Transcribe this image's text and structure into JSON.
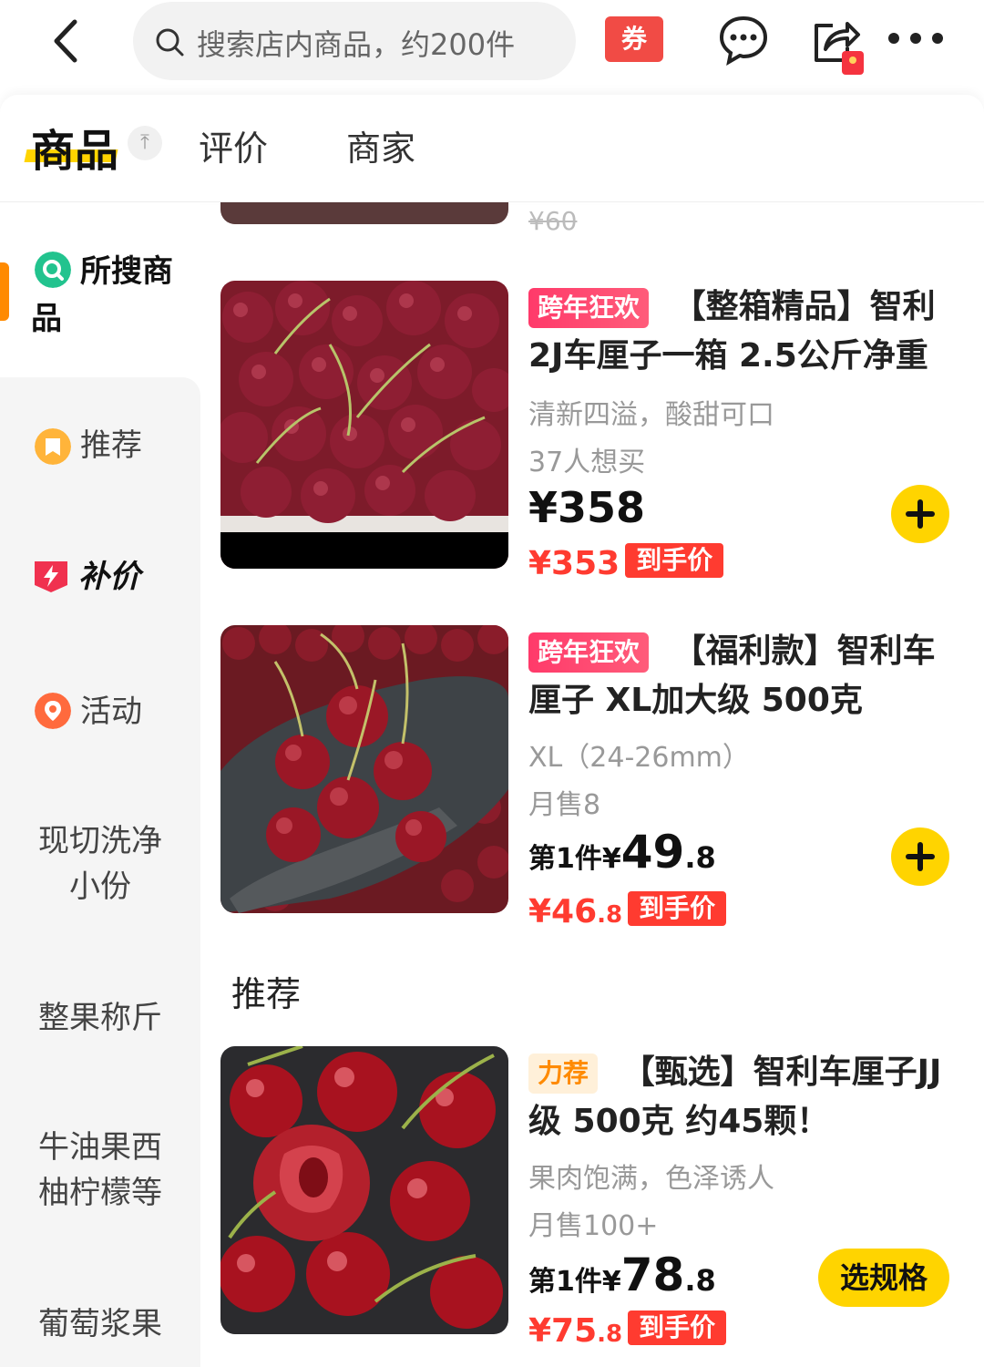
{
  "header": {
    "search_placeholder": "搜索店内商品，约200件",
    "coupon_label": "券"
  },
  "tabs": {
    "products": "商品",
    "top_button": "⤒",
    "reviews": "评价",
    "merchant": "商家"
  },
  "sidebar": {
    "items": [
      {
        "label": "所搜商品"
      },
      {
        "label": "推荐"
      },
      {
        "label": "补价"
      },
      {
        "label": "活动"
      },
      {
        "label": "现切洗净小份"
      },
      {
        "label": "整果称斤"
      },
      {
        "label": "牛油果西柚柠檬等"
      },
      {
        "label": "葡萄浆果"
      }
    ]
  },
  "prev_item": {
    "old_price": "¥60"
  },
  "products": [
    {
      "tag": "跨年狂欢",
      "title": "【整箱精品】智利2J车厘子一箱 2.5公斤净重",
      "desc": "清新四溢，酸甜可口",
      "sales": "37人想买",
      "price": "¥358",
      "final_price": "¥353",
      "final_label": "到手价"
    },
    {
      "tag": "跨年狂欢",
      "title": "【福利款】智利车厘子 XL加大级 500克",
      "desc": "XL（24-26mm）",
      "sales": "月售8",
      "price_prefix": "第1件¥",
      "price_int": "49",
      "price_dec": ".8",
      "final_int": "¥46",
      "final_dec": ".8",
      "final_label": "到手价"
    },
    {
      "tag": "力荐",
      "title": "【甄选】智利车厘子JJ级 500克 约45颗！",
      "desc": "果肉饱满，色泽诱人",
      "sales": "月售100+",
      "price_prefix": "第1件¥",
      "price_int": "78",
      "price_dec": ".8",
      "final_int": "¥75",
      "final_dec": ".8",
      "final_label": "到手价",
      "spec_label": "选规格"
    }
  ],
  "section_title": "推荐",
  "colors": {
    "accent": "#ffd400",
    "price_red": "#ff3b30",
    "tag_pink": "#ff3a6a"
  }
}
